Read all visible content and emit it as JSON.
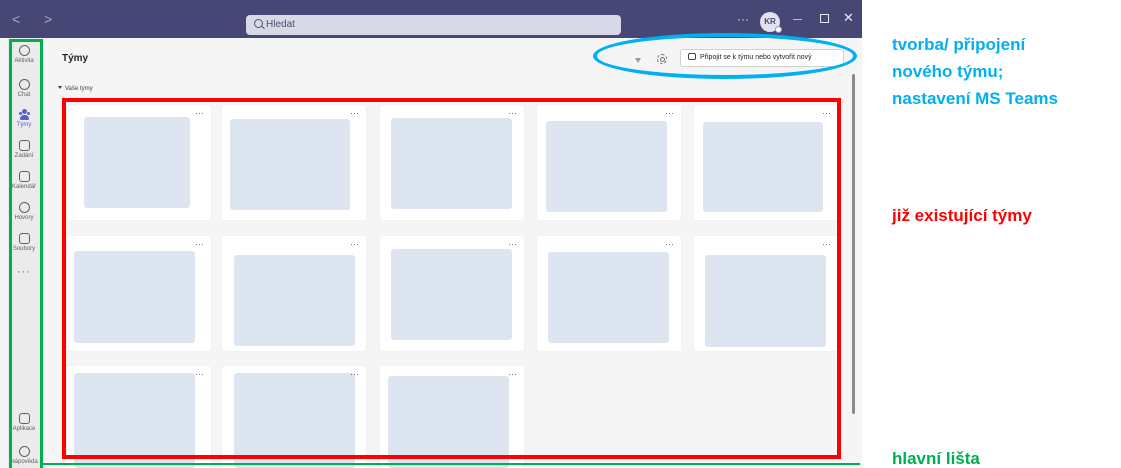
{
  "titlebar": {
    "search_placeholder": "Hledat",
    "more": "···",
    "avatar_initials": "KR"
  },
  "rail": {
    "items": [
      {
        "label": "Aktivita",
        "icon": "bell-icon"
      },
      {
        "label": "Chat",
        "icon": "chat-icon"
      },
      {
        "label": "Týmy",
        "icon": "teams-icon",
        "active": true
      },
      {
        "label": "Zadání",
        "icon": "assignments-icon"
      },
      {
        "label": "Kalendář",
        "icon": "calendar-icon"
      },
      {
        "label": "Hovory",
        "icon": "phone-icon"
      },
      {
        "label": "Soubory",
        "icon": "file-icon"
      }
    ],
    "more": "···",
    "bottom": [
      {
        "label": "Aplikace",
        "icon": "apps-icon"
      },
      {
        "label": "Nápověda",
        "icon": "help-icon"
      }
    ]
  },
  "main": {
    "title": "Týmy",
    "join_button": "Připojit se k týmu nebo vytvořit nový",
    "section_label": "Vaše týmy",
    "card_more": "···"
  },
  "annotations": {
    "create_join_line1": "tvorba/ připojení",
    "create_join_line2": "nového týmu;",
    "create_join_line3": "nastavení MS Teams",
    "existing_teams": "již existující týmy",
    "main_bar": "hlavní lišta"
  },
  "colors": {
    "titlebar": "#464775",
    "accent": "#5b5fc7",
    "annotation_blue": "#00b0f0",
    "annotation_red": "#ff0000",
    "annotation_green": "#00b050"
  }
}
